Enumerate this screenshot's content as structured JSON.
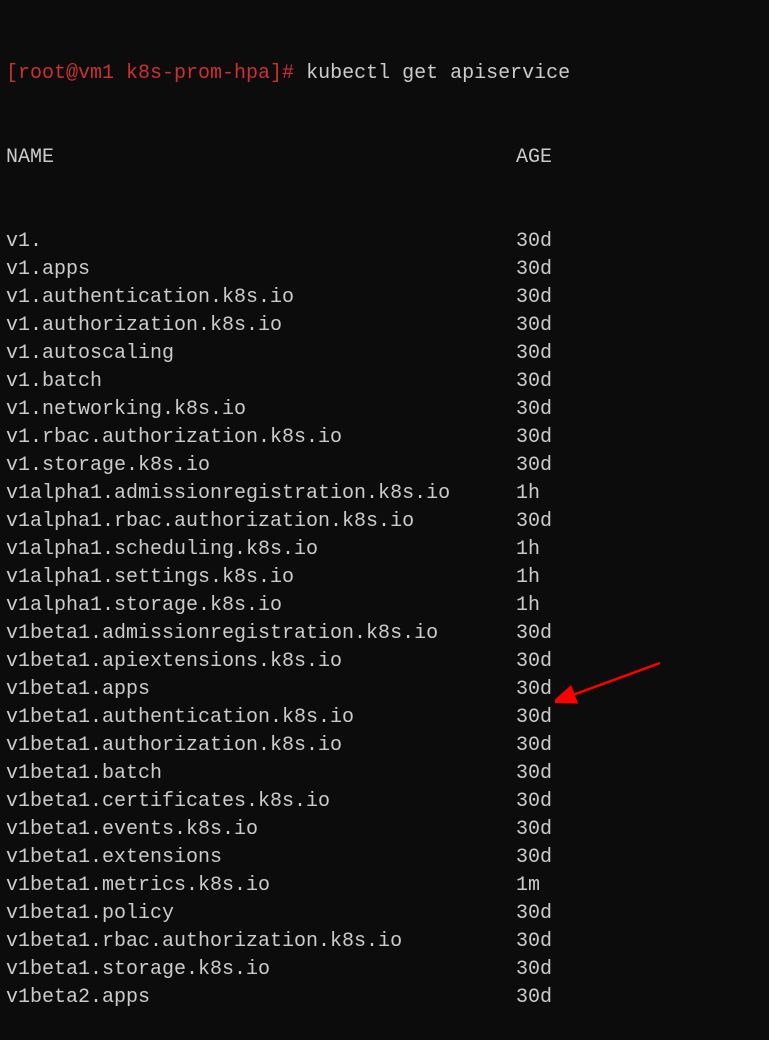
{
  "prompt": {
    "user_host": "[root@vm1 k8s-prom-hpa]",
    "hash": "#",
    "command": " kubectl get apiservice"
  },
  "header": {
    "name": "NAME",
    "age": "AGE"
  },
  "rows": [
    {
      "name": "v1.",
      "age": "30d"
    },
    {
      "name": "v1.apps",
      "age": "30d"
    },
    {
      "name": "v1.authentication.k8s.io",
      "age": "30d"
    },
    {
      "name": "v1.authorization.k8s.io",
      "age": "30d"
    },
    {
      "name": "v1.autoscaling",
      "age": "30d"
    },
    {
      "name": "v1.batch",
      "age": "30d"
    },
    {
      "name": "v1.networking.k8s.io",
      "age": "30d"
    },
    {
      "name": "v1.rbac.authorization.k8s.io",
      "age": "30d"
    },
    {
      "name": "v1.storage.k8s.io",
      "age": "30d"
    },
    {
      "name": "v1alpha1.admissionregistration.k8s.io",
      "age": "1h"
    },
    {
      "name": "v1alpha1.rbac.authorization.k8s.io",
      "age": "30d"
    },
    {
      "name": "v1alpha1.scheduling.k8s.io",
      "age": "1h"
    },
    {
      "name": "v1alpha1.settings.k8s.io",
      "age": "1h"
    },
    {
      "name": "v1alpha1.storage.k8s.io",
      "age": "1h"
    },
    {
      "name": "v1beta1.admissionregistration.k8s.io",
      "age": "30d"
    },
    {
      "name": "v1beta1.apiextensions.k8s.io",
      "age": "30d"
    },
    {
      "name": "v1beta1.apps",
      "age": "30d"
    },
    {
      "name": "v1beta1.authentication.k8s.io",
      "age": "30d"
    },
    {
      "name": "v1beta1.authorization.k8s.io",
      "age": "30d"
    },
    {
      "name": "v1beta1.batch",
      "age": "30d"
    },
    {
      "name": "v1beta1.certificates.k8s.io",
      "age": "30d"
    },
    {
      "name": "v1beta1.events.k8s.io",
      "age": "30d"
    },
    {
      "name": "v1beta1.extensions",
      "age": "30d"
    },
    {
      "name": "v1beta1.metrics.k8s.io",
      "age": "1m"
    },
    {
      "name": "v1beta1.policy",
      "age": "30d"
    },
    {
      "name": "v1beta1.rbac.authorization.k8s.io",
      "age": "30d"
    },
    {
      "name": "v1beta1.storage.k8s.io",
      "age": "30d"
    },
    {
      "name": "v1beta2.apps",
      "age": "30d"
    }
  ]
}
